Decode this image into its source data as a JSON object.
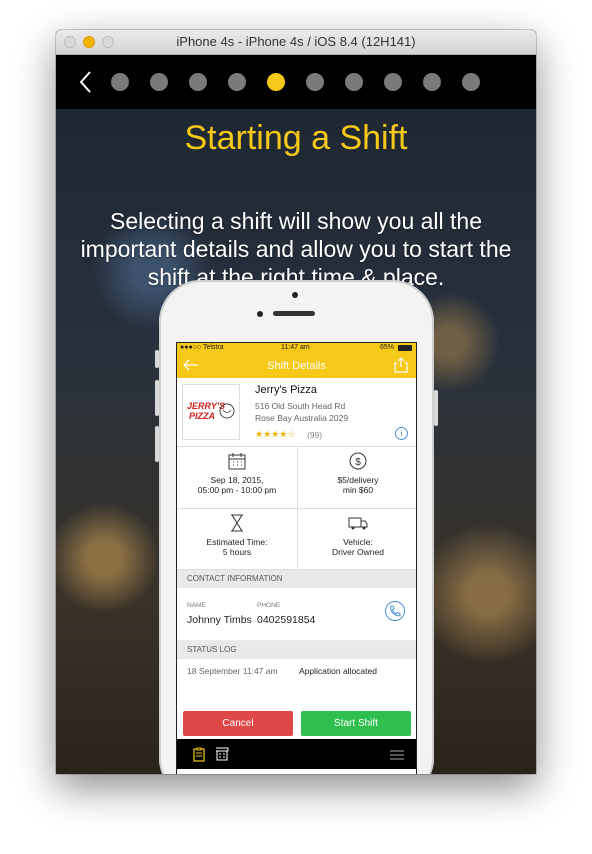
{
  "window": {
    "title": "iPhone 4s - iPhone 4s / iOS 8.4 (12H141)"
  },
  "onboarding": {
    "page_count": 10,
    "active_page": 5,
    "title": "Starting a Shift",
    "subtitle": "Selecting a shift will show you all the important details and allow you to start the shift at the right time & place.",
    "accent": "#f6c817"
  },
  "app": {
    "statusbar": {
      "carrier": "●●●○○ Telstra",
      "time": "11:47 am",
      "battery": "65%"
    },
    "navbar": {
      "title": "Shift Details"
    },
    "business": {
      "logo_text": "JERRY'S PIZZA",
      "name": "Jerry's Pizza",
      "address_line1": "516 Old South Head Rd",
      "address_line2": "Rose Bay Australia 2029",
      "rating": 3.5,
      "stars": "★★★★☆",
      "reviews": "(99)"
    },
    "details": {
      "date": "Sep 18, 2015,",
      "time": "05:00 pm - 10:00 pm",
      "pay": "$5/delivery",
      "minimum": "min $60",
      "estimated_label": "Estimated Time:",
      "estimated_value": "5 hours",
      "vehicle_label": "Vehicle:",
      "vehicle_value": "Driver Owned"
    },
    "contact": {
      "section_title": "CONTACT INFORMATION",
      "name_label": "NAME",
      "phone_label": "PHONE",
      "name": "Johnny Timbs",
      "phone": "0402591854"
    },
    "status_log": {
      "section_title": "STATUS LOG",
      "entries": [
        {
          "time": "18 September 11:47 am",
          "text": "Application allocated"
        }
      ]
    },
    "buttons": {
      "cancel": "Cancel",
      "start": "Start Shift"
    }
  }
}
